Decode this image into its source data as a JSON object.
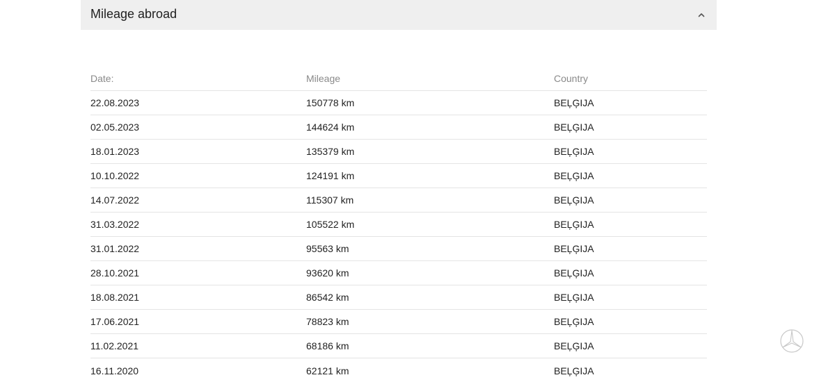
{
  "section": {
    "title": "Mileage abroad",
    "expanded": true,
    "toggle_icon": "chevron-up-icon"
  },
  "table": {
    "headers": {
      "date": "Date:",
      "mileage": "Mileage",
      "country": "Country"
    },
    "rows": [
      {
        "date": "22.08.2023",
        "mileage": "150778 km",
        "country": "BEĻĢIJA"
      },
      {
        "date": "02.05.2023",
        "mileage": "144624 km",
        "country": "BEĻĢIJA"
      },
      {
        "date": "18.01.2023",
        "mileage": "135379 km",
        "country": "BEĻĢIJA"
      },
      {
        "date": "10.10.2022",
        "mileage": "124191 km",
        "country": "BEĻĢIJA"
      },
      {
        "date": "14.07.2022",
        "mileage": "115307 km",
        "country": "BEĻĢIJA"
      },
      {
        "date": "31.03.2022",
        "mileage": "105522 km",
        "country": "BEĻĢIJA"
      },
      {
        "date": "31.01.2022",
        "mileage": "95563 km",
        "country": "BEĻĢIJA"
      },
      {
        "date": "28.10.2021",
        "mileage": "93620 km",
        "country": "BEĻĢIJA"
      },
      {
        "date": "18.08.2021",
        "mileage": "86542 km",
        "country": "BEĻĢIJA"
      },
      {
        "date": "17.06.2021",
        "mileage": "78823 km",
        "country": "BEĻĢIJA"
      },
      {
        "date": "11.02.2021",
        "mileage": "68186 km",
        "country": "BEĻĢIJA"
      },
      {
        "date": "16.11.2020",
        "mileage": "62121 km",
        "country": "BEĻĢIJA"
      }
    ]
  },
  "watermark": {
    "icon": "mercedes-star-logo-icon"
  }
}
